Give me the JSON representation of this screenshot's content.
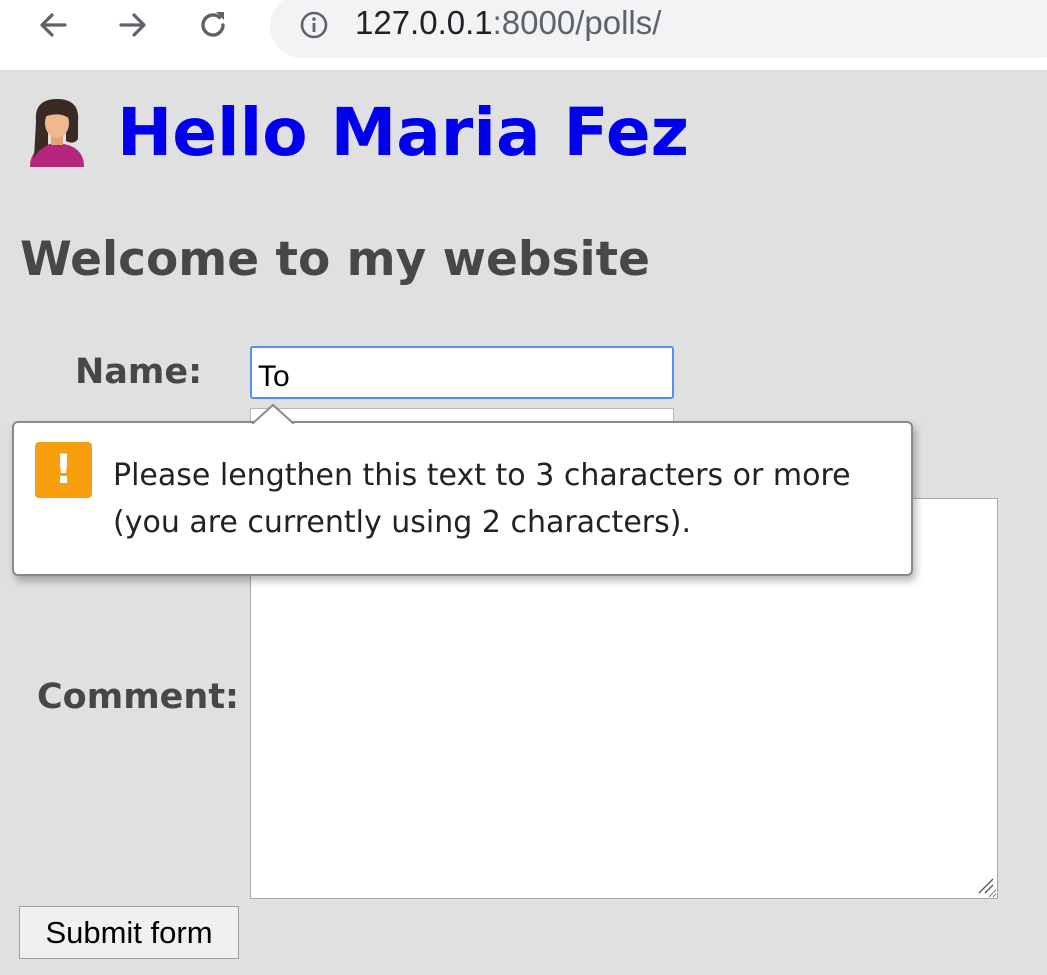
{
  "browser": {
    "url_host": "127.0.0.1",
    "url_rest": ":8000/polls/",
    "icons": [
      "back-arrow-icon",
      "forward-arrow-icon",
      "reload-icon",
      "site-info-icon"
    ]
  },
  "page": {
    "greeting": "Hello Maria Fez",
    "subtitle": "Welcome to my website",
    "name_label": "Name:",
    "name_value": "To",
    "comment_label": "Comment:",
    "submit_label": "Submit form"
  },
  "validation": {
    "message": "Please lengthen this text to 3 characters or more (you are currently using 2 characters).",
    "icon": "warning-icon",
    "icon_glyph": "!"
  },
  "colors": {
    "greeting": "#0000ee",
    "heading": "#474747",
    "background": "#e0e0e0",
    "warning": "#f5a00c",
    "focus_border": "#5b8dee"
  }
}
